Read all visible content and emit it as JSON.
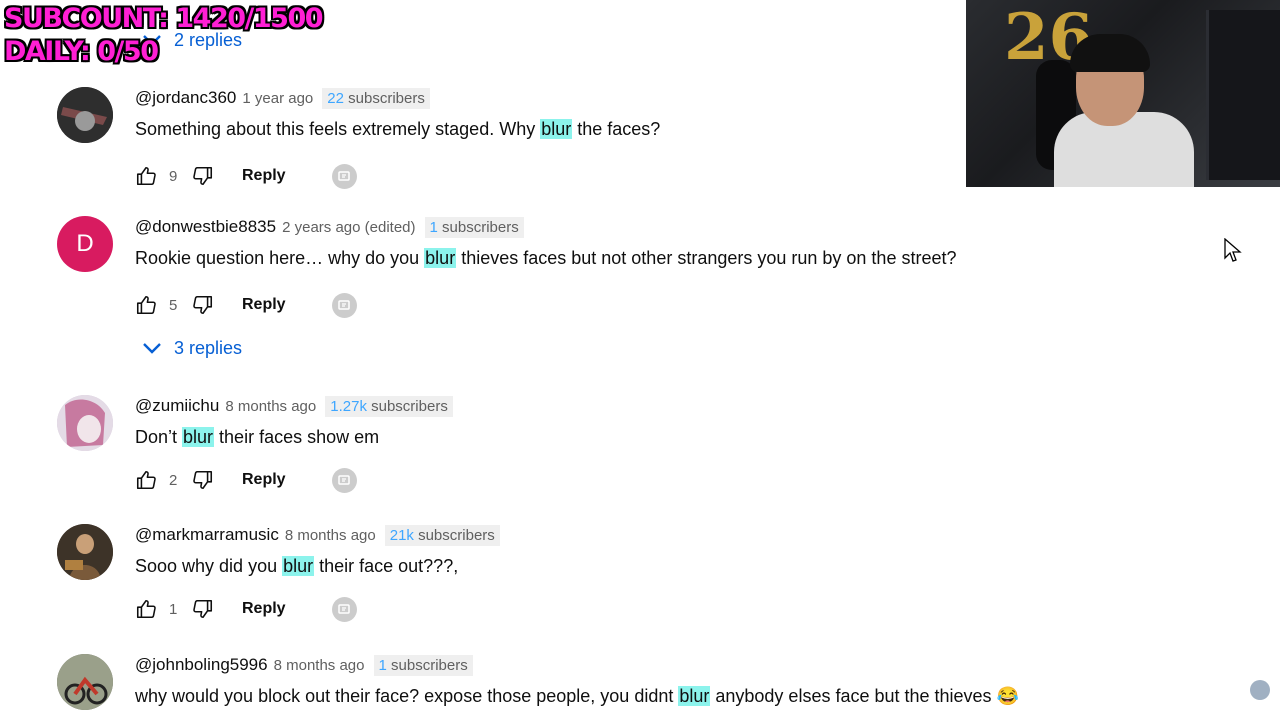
{
  "overlay": {
    "line1": "SUBCOUNT: 1420/1500",
    "line2": "DAILY: 0/50"
  },
  "top_replies": {
    "label": "2 replies"
  },
  "comments": [
    {
      "handle": "@jordanc360",
      "time": "1 year ago",
      "subs_num": "22",
      "subs_word": " subscribers",
      "text_before": "Something about this feels extremely staged. Why ",
      "highlight": "blur",
      "text_after": " the faces?",
      "likes": "9",
      "reply_label": "Reply",
      "avatar_color": "#3a3a3a",
      "avatar_initial": ""
    },
    {
      "handle": "@donwestbie8835",
      "time": "2 years ago (edited)",
      "subs_num": "1",
      "subs_word": " subscribers",
      "text_before": "Rookie question here… why do you ",
      "highlight": "blur",
      "text_after": " thieves faces but not other strangers you run by on the street?",
      "likes": "5",
      "reply_label": "Reply",
      "avatar_color": "#d81b60",
      "avatar_initial": "D"
    },
    {
      "handle": "@zumiichu",
      "time": "8 months ago",
      "subs_num": "1.27k",
      "subs_word": " subscribers",
      "text_before": "Don’t ",
      "highlight": "blur",
      "text_after": " their faces show em",
      "likes": "2",
      "reply_label": "Reply",
      "avatar_color": "#cfc8d6",
      "avatar_initial": ""
    },
    {
      "handle": "@markmarramusic",
      "time": "8 months ago",
      "subs_num": "21k",
      "subs_word": " subscribers",
      "text_before": "Sooo why did you ",
      "highlight": "blur",
      "text_after": " their face out???,",
      "likes": "1",
      "reply_label": "Reply",
      "avatar_color": "#5a4a3a",
      "avatar_initial": ""
    },
    {
      "handle": "@johnboling5996",
      "time": "8 months ago",
      "subs_num": "1",
      "subs_word": " subscribers",
      "text_before": "why would you block out their face? expose those people, you didnt ",
      "highlight": "blur",
      "text_after": " anybody elses face but the thieves 😂",
      "likes": "",
      "reply_label": "",
      "avatar_color": "#6b6b60",
      "avatar_initial": ""
    }
  ],
  "mid_replies": {
    "label": "3 replies"
  },
  "colors": {
    "link": "#065fd4",
    "highlight": "#8cf3ec",
    "overlay_text": "#ff1fd4"
  }
}
